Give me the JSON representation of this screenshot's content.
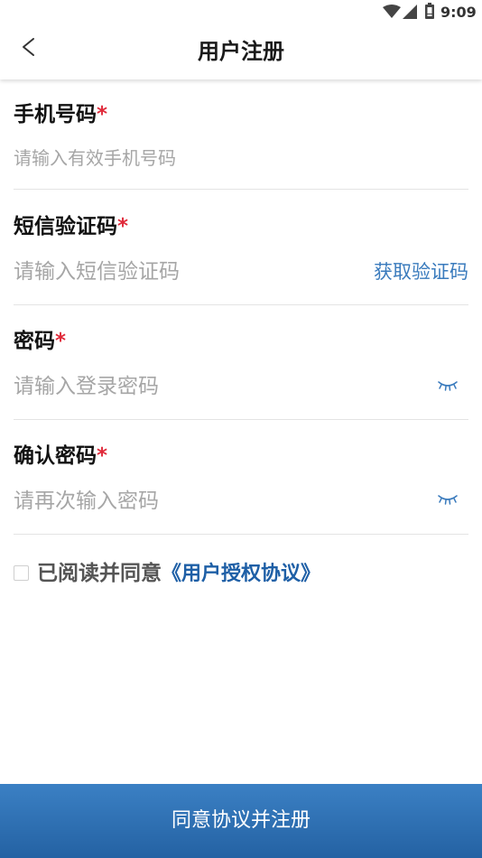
{
  "status_bar": {
    "time": "9:09",
    "icons": [
      "wifi-icon",
      "cell-signal-icon",
      "battery-icon"
    ]
  },
  "header": {
    "back_icon": "chevron-left-icon",
    "title": "用户注册"
  },
  "form": {
    "fields": [
      {
        "label": "手机号码",
        "required_mark": "*",
        "placeholder": "请输入有效手机号码",
        "value": ""
      },
      {
        "label": "短信验证码",
        "required_mark": "*",
        "placeholder": "请输入短信验证码",
        "value": "",
        "action_label": "获取验证码"
      },
      {
        "label": "密码",
        "required_mark": "*",
        "placeholder": "请输入登录密码",
        "value": "",
        "toggle_icon": "eye-closed-icon"
      },
      {
        "label": "确认密码",
        "required_mark": "*",
        "placeholder": "请再次输入密码",
        "value": "",
        "toggle_icon": "eye-closed-icon"
      }
    ]
  },
  "agreement": {
    "checked": false,
    "prefix": "已阅读并同意",
    "link_label": "《用户授权协议》"
  },
  "submit": {
    "label": "同意协议并注册"
  },
  "colors": {
    "accent": "#3a7bbd",
    "link": "#1e5fa6",
    "required": "#e02a3a",
    "button_top": "#3b80c4",
    "button_bottom": "#2462a3",
    "placeholder": "#a6a6a6",
    "divider": "#e4e4e4",
    "text": "#111111"
  }
}
